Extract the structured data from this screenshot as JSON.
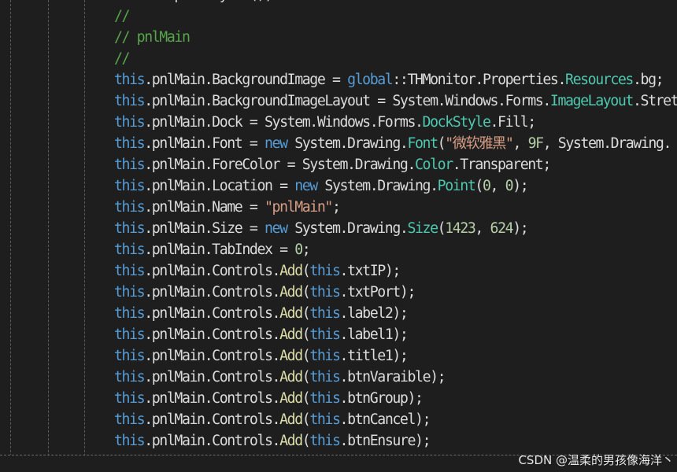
{
  "colors": {
    "background": "#1e1e1e",
    "default": "#dcdcdc",
    "keyword": "#569cd6",
    "type": "#4ec9b0",
    "method": "#dcdcaa",
    "string": "#d69d85",
    "number": "#b5cea8",
    "comment": "#57a64a"
  },
  "editor": {
    "lines": [
      [
        {
          "t": "this",
          "c": "keyword"
        },
        {
          "t": ".SuspendLayout();",
          "c": "default"
        }
      ],
      [
        {
          "t": "//",
          "c": "comment"
        }
      ],
      [
        {
          "t": "// pnlMain",
          "c": "comment"
        }
      ],
      [
        {
          "t": "//",
          "c": "comment"
        }
      ],
      [
        {
          "t": "this",
          "c": "keyword"
        },
        {
          "t": ".pnlMain.BackgroundImage = ",
          "c": "default"
        },
        {
          "t": "global",
          "c": "keyword"
        },
        {
          "t": "::THMonitor.Properties.",
          "c": "default"
        },
        {
          "t": "Resources",
          "c": "type"
        },
        {
          "t": ".bg;",
          "c": "default"
        }
      ],
      [
        {
          "t": "this",
          "c": "keyword"
        },
        {
          "t": ".pnlMain.BackgroundImageLayout = System.Windows.Forms.",
          "c": "default"
        },
        {
          "t": "ImageLayout",
          "c": "type"
        },
        {
          "t": ".Stretch;",
          "c": "default"
        }
      ],
      [
        {
          "t": "this",
          "c": "keyword"
        },
        {
          "t": ".pnlMain.Dock = System.Windows.Forms.",
          "c": "default"
        },
        {
          "t": "DockStyle",
          "c": "type"
        },
        {
          "t": ".Fill;",
          "c": "default"
        }
      ],
      [
        {
          "t": "this",
          "c": "keyword"
        },
        {
          "t": ".pnlMain.Font = ",
          "c": "default"
        },
        {
          "t": "new",
          "c": "keyword"
        },
        {
          "t": " System.Drawing.",
          "c": "default"
        },
        {
          "t": "Font",
          "c": "type"
        },
        {
          "t": "(",
          "c": "default"
        },
        {
          "t": "\"微软雅黑\"",
          "c": "string"
        },
        {
          "t": ", ",
          "c": "default"
        },
        {
          "t": "9F",
          "c": "number"
        },
        {
          "t": ", System.Drawing.",
          "c": "default"
        }
      ],
      [
        {
          "t": "this",
          "c": "keyword"
        },
        {
          "t": ".pnlMain.ForeColor = System.Drawing.",
          "c": "default"
        },
        {
          "t": "Color",
          "c": "type"
        },
        {
          "t": ".Transparent;",
          "c": "default"
        }
      ],
      [
        {
          "t": "this",
          "c": "keyword"
        },
        {
          "t": ".pnlMain.Location = ",
          "c": "default"
        },
        {
          "t": "new",
          "c": "keyword"
        },
        {
          "t": " System.Drawing.",
          "c": "default"
        },
        {
          "t": "Point",
          "c": "type"
        },
        {
          "t": "(",
          "c": "default"
        },
        {
          "t": "0",
          "c": "number"
        },
        {
          "t": ", ",
          "c": "default"
        },
        {
          "t": "0",
          "c": "number"
        },
        {
          "t": ");",
          "c": "default"
        }
      ],
      [
        {
          "t": "this",
          "c": "keyword"
        },
        {
          "t": ".pnlMain.Name = ",
          "c": "default"
        },
        {
          "t": "\"pnlMain\"",
          "c": "string"
        },
        {
          "t": ";",
          "c": "default"
        }
      ],
      [
        {
          "t": "this",
          "c": "keyword"
        },
        {
          "t": ".pnlMain.Size = ",
          "c": "default"
        },
        {
          "t": "new",
          "c": "keyword"
        },
        {
          "t": " System.Drawing.",
          "c": "default"
        },
        {
          "t": "Size",
          "c": "type"
        },
        {
          "t": "(",
          "c": "default"
        },
        {
          "t": "1423",
          "c": "number"
        },
        {
          "t": ", ",
          "c": "default"
        },
        {
          "t": "624",
          "c": "number"
        },
        {
          "t": ");",
          "c": "default"
        }
      ],
      [
        {
          "t": "this",
          "c": "keyword"
        },
        {
          "t": ".pnlMain.TabIndex = ",
          "c": "default"
        },
        {
          "t": "0",
          "c": "number"
        },
        {
          "t": ";",
          "c": "default"
        }
      ],
      [
        {
          "t": "this",
          "c": "keyword"
        },
        {
          "t": ".pnlMain.Controls.",
          "c": "default"
        },
        {
          "t": "Add",
          "c": "method"
        },
        {
          "t": "(",
          "c": "default"
        },
        {
          "t": "this",
          "c": "keyword"
        },
        {
          "t": ".txtIP);",
          "c": "default"
        }
      ],
      [
        {
          "t": "this",
          "c": "keyword"
        },
        {
          "t": ".pnlMain.Controls.",
          "c": "default"
        },
        {
          "t": "Add",
          "c": "method"
        },
        {
          "t": "(",
          "c": "default"
        },
        {
          "t": "this",
          "c": "keyword"
        },
        {
          "t": ".txtPort);",
          "c": "default"
        }
      ],
      [
        {
          "t": "this",
          "c": "keyword"
        },
        {
          "t": ".pnlMain.Controls.",
          "c": "default"
        },
        {
          "t": "Add",
          "c": "method"
        },
        {
          "t": "(",
          "c": "default"
        },
        {
          "t": "this",
          "c": "keyword"
        },
        {
          "t": ".label2);",
          "c": "default"
        }
      ],
      [
        {
          "t": "this",
          "c": "keyword"
        },
        {
          "t": ".pnlMain.Controls.",
          "c": "default"
        },
        {
          "t": "Add",
          "c": "method"
        },
        {
          "t": "(",
          "c": "default"
        },
        {
          "t": "this",
          "c": "keyword"
        },
        {
          "t": ".label1);",
          "c": "default"
        }
      ],
      [
        {
          "t": "this",
          "c": "keyword"
        },
        {
          "t": ".pnlMain.Controls.",
          "c": "default"
        },
        {
          "t": "Add",
          "c": "method"
        },
        {
          "t": "(",
          "c": "default"
        },
        {
          "t": "this",
          "c": "keyword"
        },
        {
          "t": ".title1);",
          "c": "default"
        }
      ],
      [
        {
          "t": "this",
          "c": "keyword"
        },
        {
          "t": ".pnlMain.Controls.",
          "c": "default"
        },
        {
          "t": "Add",
          "c": "method"
        },
        {
          "t": "(",
          "c": "default"
        },
        {
          "t": "this",
          "c": "keyword"
        },
        {
          "t": ".btnVaraible);",
          "c": "default"
        }
      ],
      [
        {
          "t": "this",
          "c": "keyword"
        },
        {
          "t": ".pnlMain.Controls.",
          "c": "default"
        },
        {
          "t": "Add",
          "c": "method"
        },
        {
          "t": "(",
          "c": "default"
        },
        {
          "t": "this",
          "c": "keyword"
        },
        {
          "t": ".btnGroup);",
          "c": "default"
        }
      ],
      [
        {
          "t": "this",
          "c": "keyword"
        },
        {
          "t": ".pnlMain.Controls.",
          "c": "default"
        },
        {
          "t": "Add",
          "c": "method"
        },
        {
          "t": "(",
          "c": "default"
        },
        {
          "t": "this",
          "c": "keyword"
        },
        {
          "t": ".btnCancel);",
          "c": "default"
        }
      ],
      [
        {
          "t": "this",
          "c": "keyword"
        },
        {
          "t": ".pnlMain.Controls.",
          "c": "default"
        },
        {
          "t": "Add",
          "c": "method"
        },
        {
          "t": "(",
          "c": "default"
        },
        {
          "t": "this",
          "c": "keyword"
        },
        {
          "t": ".btnEnsure);",
          "c": "default"
        }
      ]
    ]
  },
  "watermark": "CSDN @温柔的男孩像海洋丶"
}
